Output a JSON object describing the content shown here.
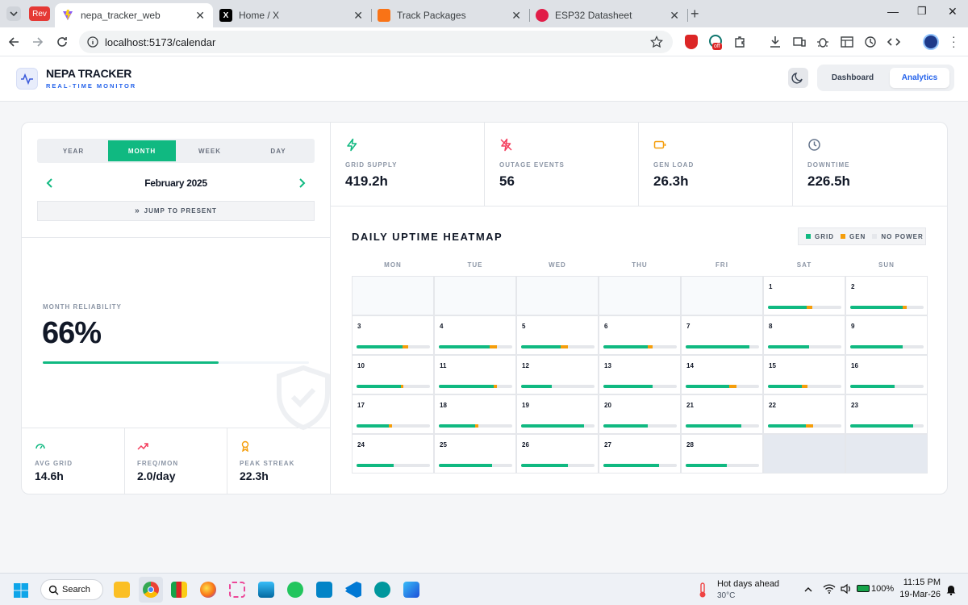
{
  "browser": {
    "tabs": [
      {
        "label": "nepa_tracker_web",
        "active": true
      },
      {
        "label": "Home / X",
        "active": false
      },
      {
        "label": "Track Packages",
        "active": false
      },
      {
        "label": "ESP32 Datasheet",
        "active": false
      }
    ],
    "rev_label": "Rev",
    "url": "localhost:5173/calendar",
    "ext_badge": "off"
  },
  "app": {
    "name": "NEPA TRACKER",
    "subtitle": "REAL-TIME MONITOR",
    "nav": {
      "dashboard": "Dashboard",
      "analytics": "Analytics",
      "active": "Analytics"
    }
  },
  "calendar": {
    "modes": [
      "YEAR",
      "MONTH",
      "WEEK",
      "DAY"
    ],
    "active_mode": "MONTH",
    "period": "February 2025",
    "jump_label": "JUMP TO PRESENT"
  },
  "reliability": {
    "label": "MONTH RELIABILITY",
    "value": "66%",
    "fraction": 0.66
  },
  "mini_stats": [
    {
      "label": "AVG GRID",
      "value": "14.6h",
      "icon": "gauge-icon"
    },
    {
      "label": "FREQ/MON",
      "value": "2.0/day",
      "icon": "trending-up-icon"
    },
    {
      "label": "PEAK STREAK",
      "value": "22.3h",
      "icon": "award-icon"
    }
  ],
  "stats": [
    {
      "label": "GRID SUPPLY",
      "value": "419.2h",
      "icon": "zap-icon",
      "color": "#10b981"
    },
    {
      "label": "OUTAGE EVENTS",
      "value": "56",
      "icon": "zap-off-icon",
      "color": "#f43f5e"
    },
    {
      "label": "GEN LOAD",
      "value": "26.3h",
      "icon": "battery-icon",
      "color": "#f59e0b"
    },
    {
      "label": "DOWNTIME",
      "value": "226.5h",
      "icon": "clock-icon",
      "color": "#64748b"
    }
  ],
  "heatmap": {
    "title": "DAILY UPTIME HEATMAP",
    "legend": [
      {
        "label": "GRID",
        "color": "#10b981"
      },
      {
        "label": "GEN",
        "color": "#f59e0b"
      },
      {
        "label": "NO POWER",
        "color": "#e5e7eb"
      }
    ],
    "weekdays": [
      "MON",
      "TUE",
      "WED",
      "THU",
      "FRI",
      "SAT",
      "SUN"
    ],
    "leading_blanks": 5,
    "days": [
      {
        "day": "1",
        "grid": 0.53,
        "gen": 0.07
      },
      {
        "day": "2",
        "grid": 0.71,
        "gen": 0.06
      },
      {
        "day": "3",
        "grid": 0.63,
        "gen": 0.07
      },
      {
        "day": "4",
        "grid": 0.69,
        "gen": 0.1
      },
      {
        "day": "5",
        "grid": 0.54,
        "gen": 0.1
      },
      {
        "day": "6",
        "grid": 0.6,
        "gen": 0.07
      },
      {
        "day": "7",
        "grid": 0.87,
        "gen": 0.0
      },
      {
        "day": "8",
        "grid": 0.56,
        "gen": 0.0
      },
      {
        "day": "9",
        "grid": 0.71,
        "gen": 0.0
      },
      {
        "day": "10",
        "grid": 0.6,
        "gen": 0.04
      },
      {
        "day": "11",
        "grid": 0.75,
        "gen": 0.04
      },
      {
        "day": "12",
        "grid": 0.42,
        "gen": 0.0
      },
      {
        "day": "13",
        "grid": 0.67,
        "gen": 0.0
      },
      {
        "day": "14",
        "grid": 0.59,
        "gen": 0.1
      },
      {
        "day": "15",
        "grid": 0.46,
        "gen": 0.08
      },
      {
        "day": "16",
        "grid": 0.6,
        "gen": 0.0
      },
      {
        "day": "17",
        "grid": 0.44,
        "gen": 0.04
      },
      {
        "day": "18",
        "grid": 0.49,
        "gen": 0.05
      },
      {
        "day": "19",
        "grid": 0.86,
        "gen": 0.0
      },
      {
        "day": "20",
        "grid": 0.6,
        "gen": 0.0
      },
      {
        "day": "21",
        "grid": 0.76,
        "gen": 0.0
      },
      {
        "day": "22",
        "grid": 0.52,
        "gen": 0.1
      },
      {
        "day": "23",
        "grid": 0.86,
        "gen": 0.0
      },
      {
        "day": "24",
        "grid": 0.5,
        "gen": 0.0
      },
      {
        "day": "25",
        "grid": 0.73,
        "gen": 0.0
      },
      {
        "day": "26",
        "grid": 0.64,
        "gen": 0.0
      },
      {
        "day": "27",
        "grid": 0.76,
        "gen": 0.0
      },
      {
        "day": "28",
        "grid": 0.56,
        "gen": 0.0
      }
    ]
  },
  "taskbar": {
    "search": "Search",
    "weather_title": "Hot days ahead",
    "weather_temp": "30°C",
    "battery": "100%",
    "time": "11:15 PM",
    "date": "19-Mar-26"
  }
}
